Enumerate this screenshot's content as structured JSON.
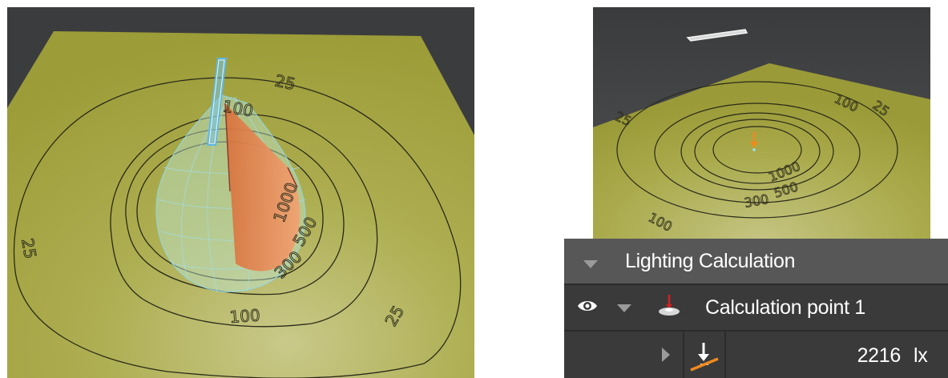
{
  "left_view": {
    "contour_labels": [
      "25",
      "100",
      "300",
      "500",
      "1000",
      "25",
      "25",
      "100"
    ]
  },
  "right_view": {
    "contour_labels": [
      "25",
      "25",
      "100",
      "1000",
      "500",
      "300",
      "100"
    ]
  },
  "panel": {
    "section_title": "Lighting Calculation",
    "item_label": "Calculation point 1",
    "value": "2216",
    "unit": "lx"
  },
  "icons": {
    "visibility": "eye-icon",
    "expand": "triangle-down-icon",
    "collapsed": "triangle-right-icon",
    "calc_point": "calculation-point-icon",
    "direction": "down-arrow-on-plane-icon"
  },
  "colors": {
    "floor": "#a5a53f",
    "background": "#3b3c3e",
    "luminaire": "#6fc3e8",
    "light_cone": "#f09060",
    "panel_dark": "#3a3a3a",
    "panel_header": "#575757",
    "arrow_orange": "#f08a1e"
  }
}
